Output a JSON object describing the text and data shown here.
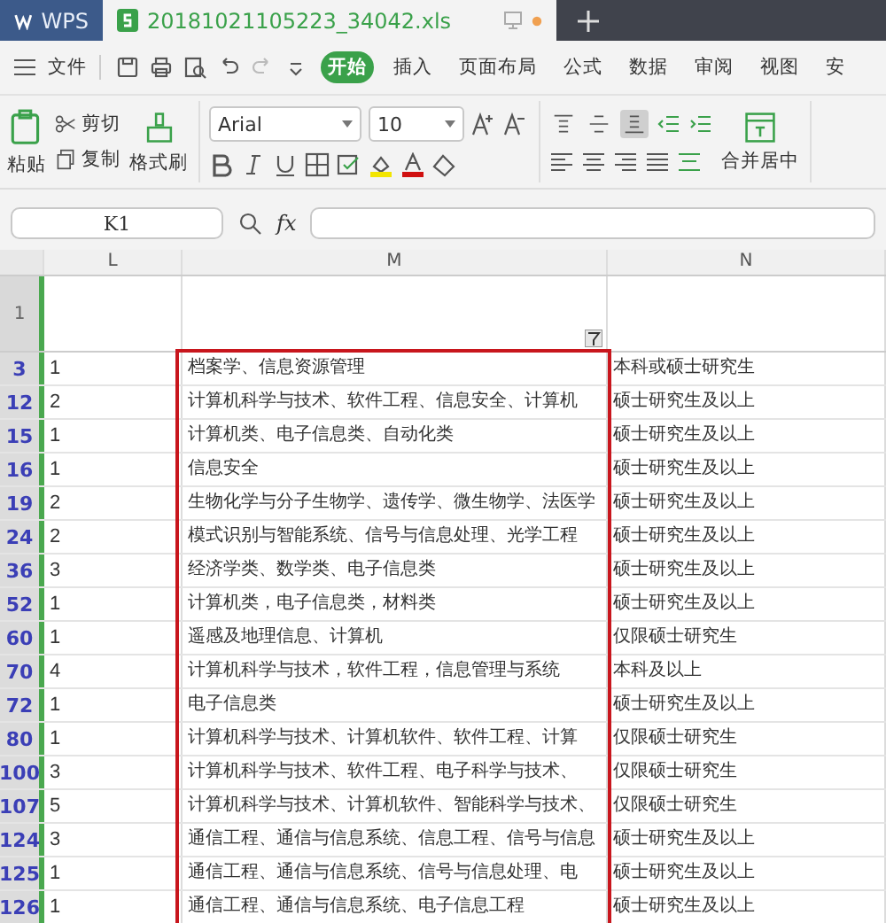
{
  "tabs": [
    {
      "label": "WPS",
      "kind": "app",
      "selected": false
    },
    {
      "label": "20181021105223_34042.xls",
      "kind": "file",
      "selected": true
    }
  ],
  "menu": {
    "file": "文件",
    "ribbon_tabs": [
      {
        "label": "开始",
        "selected": true
      },
      {
        "label": "插入",
        "selected": false
      },
      {
        "label": "页面布局",
        "selected": false
      },
      {
        "label": "公式",
        "selected": false
      },
      {
        "label": "数据",
        "selected": false
      },
      {
        "label": "审阅",
        "selected": false
      },
      {
        "label": "视图",
        "selected": false
      },
      {
        "label": "安",
        "selected": false
      }
    ]
  },
  "ribbon": {
    "paste": "粘贴",
    "cut": "剪切",
    "copy": "复制",
    "format_painter": "格式刷",
    "font": "Arial",
    "font_size": "10",
    "merge": "合并居中",
    "vertical_align": [
      {
        "kind": "top",
        "selected": false
      },
      {
        "kind": "middle",
        "selected": false
      },
      {
        "kind": "bottom",
        "selected": true
      }
    ]
  },
  "formula_bar": {
    "name_box": "K1",
    "fx": "fx"
  },
  "sheet": {
    "columns": [
      "L",
      "M",
      "N"
    ],
    "header_row": "1",
    "rows": [
      {
        "row": "3",
        "l": "1",
        "m": "档案学、信息资源管理",
        "n": "本科或硕士研究生"
      },
      {
        "row": "12",
        "l": "2",
        "m": "计算机科学与技术、软件工程、信息安全、计算机",
        "n": "硕士研究生及以上"
      },
      {
        "row": "15",
        "l": "1",
        "m": "计算机类、电子信息类、自动化类",
        "n": "硕士研究生及以上"
      },
      {
        "row": "16",
        "l": "1",
        "m": "信息安全",
        "n": "硕士研究生及以上"
      },
      {
        "row": "19",
        "l": "2",
        "m": "生物化学与分子生物学、遗传学、微生物学、法医学",
        "n": "硕士研究生及以上"
      },
      {
        "row": "24",
        "l": "2",
        "m": "模式识别与智能系统、信号与信息处理、光学工程",
        "n": "硕士研究生及以上"
      },
      {
        "row": "36",
        "l": "3",
        "m": "经济学类、数学类、电子信息类",
        "n": "硕士研究生及以上"
      },
      {
        "row": "52",
        "l": "1",
        "m": "计算机类，电子信息类，材料类",
        "n": "硕士研究生及以上"
      },
      {
        "row": "60",
        "l": "1",
        "m": "遥感及地理信息、计算机",
        "n": "仅限硕士研究生"
      },
      {
        "row": "70",
        "l": "4",
        "m": "计算机科学与技术，软件工程，信息管理与系统",
        "n": "本科及以上"
      },
      {
        "row": "72",
        "l": "1",
        "m": "电子信息类",
        "n": "硕士研究生及以上"
      },
      {
        "row": "80",
        "l": "1",
        "m": "计算机科学与技术、计算机软件、软件工程、计算",
        "n": "仅限硕士研究生"
      },
      {
        "row": "100",
        "l": "3",
        "m": "计算机科学与技术、软件工程、电子科学与技术、",
        "n": "仅限硕士研究生"
      },
      {
        "row": "107",
        "l": "5",
        "m": "计算机科学与技术、计算机软件、智能科学与技术、",
        "n": "仅限硕士研究生"
      },
      {
        "row": "124",
        "l": "3",
        "m": "通信工程、通信与信息系统、信息工程、信号与信息",
        "n": "硕士研究生及以上"
      },
      {
        "row": "125",
        "l": "1",
        "m": "通信工程、通信与信息系统、信号与信息处理、电",
        "n": "硕士研究生及以上"
      },
      {
        "row": "126",
        "l": "1",
        "m": "通信工程、通信与信息系统、电子信息工程",
        "n": "硕士研究生及以上"
      }
    ]
  }
}
